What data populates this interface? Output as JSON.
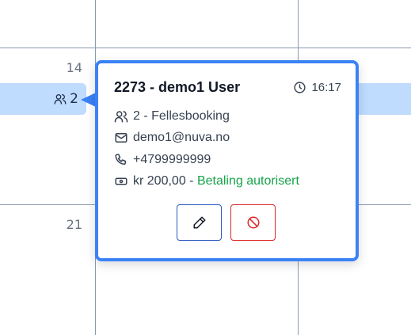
{
  "calendar": {
    "day_14": "14",
    "day_21": "21",
    "event_count": "2"
  },
  "popover": {
    "title": "2273 - demo1 User",
    "time": "16:17",
    "booking_type": "2 - Fellesbooking",
    "email": "demo1@nuva.no",
    "phone": "+4799999999",
    "amount": "kr 200,00",
    "separator": " - ",
    "payment_status": "Betaling autorisert",
    "edit_icon": "pencil-icon",
    "cancel_icon": "ban-icon"
  },
  "colors": {
    "accent": "#3b82f6",
    "event_bg": "#bfdbfe",
    "success": "#16a34a",
    "danger": "#dc2626"
  }
}
